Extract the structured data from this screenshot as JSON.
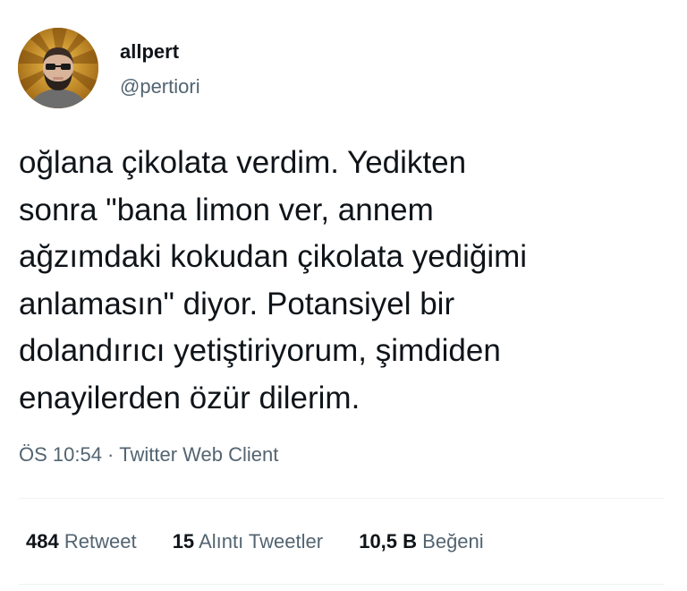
{
  "author": {
    "display_name": "allpert",
    "handle": "@pertiori"
  },
  "tweet": {
    "lines": [
      "oğlana çikolata verdim. Yedikten",
      "sonra \"bana limon ver, annem",
      "ağzımdaki kokudan çikolata yediğimi",
      "anlamasın\" diyor. Potansiyel bir",
      "dolandırıcı yetiştiriyorum, şimdiden",
      "enayilerden özür dilerim."
    ],
    "time": "ÖS 10:54",
    "separator": "·",
    "client": "Twitter Web Client"
  },
  "stats": [
    {
      "count": "484",
      "label": "Retweet"
    },
    {
      "count": "15",
      "label": "Alıntı Tweetler"
    },
    {
      "count": "10,5 B",
      "label": "Beğeni"
    }
  ]
}
